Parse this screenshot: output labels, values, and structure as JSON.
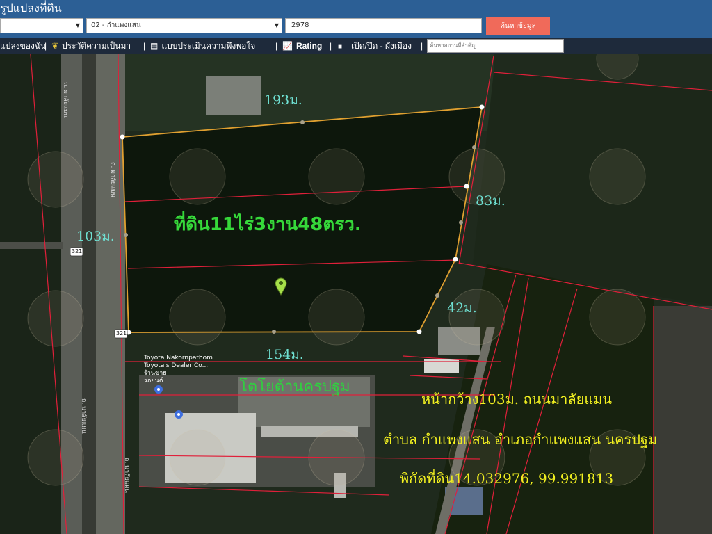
{
  "header": {
    "title": "รูปแปลงที่ดิน",
    "province_select": "",
    "district_select": "02 - กำแพงแสน",
    "code_value": "2978",
    "search_button": "ค้นหาข้อมูล"
  },
  "toolbar": {
    "my_parcels": "แปลงของฉัน",
    "history": "ประวัติความเป็นมา",
    "satisfaction": "แบบประเมินความพึงพอใจ",
    "rating": "Rating",
    "toggle_plan": "เปิด/ปิด - ผังเมือง",
    "place_placeholder": "ค้นหาสถานที่สำคัญ"
  },
  "map": {
    "dim_top": "193ม.",
    "dim_right": "83ม.",
    "dim_left": "103ม.",
    "dim_bottom_right": "42ม.",
    "dim_bottom": "154ม.",
    "area_label": "ที่ดิน11ไร่3งาน48ตรว.",
    "building_label": "โตโยต้านครปฐม",
    "info_line1": "หน้ากว้าง103ม. ถนนมาลัยแมน",
    "info_line2": "ตำบล กำแพงแสน อำเภอกำแพงแสน นครปฐม",
    "info_line3": "พิกัดที่ดิน14.032976, 99.991813",
    "road_name": "ถ. มาลัยแมน",
    "route_number": "321",
    "business_line1": "Toyota Nakornpathom",
    "business_line2": "Toyota's Dealer Co...",
    "business_line3": "ร้านขาย",
    "business_line4": "รถยนต์"
  },
  "colors": {
    "header_bg": "#2c5f95",
    "toolbar_bg": "#1e2a3b",
    "search_button_bg": "#f06a5a",
    "parcel_outline": "#e0a030",
    "parcel_lines": "#e0203a",
    "dimension_text": "#6fe0d2",
    "area_text": "#36d83a",
    "info_text": "#f2f020"
  }
}
